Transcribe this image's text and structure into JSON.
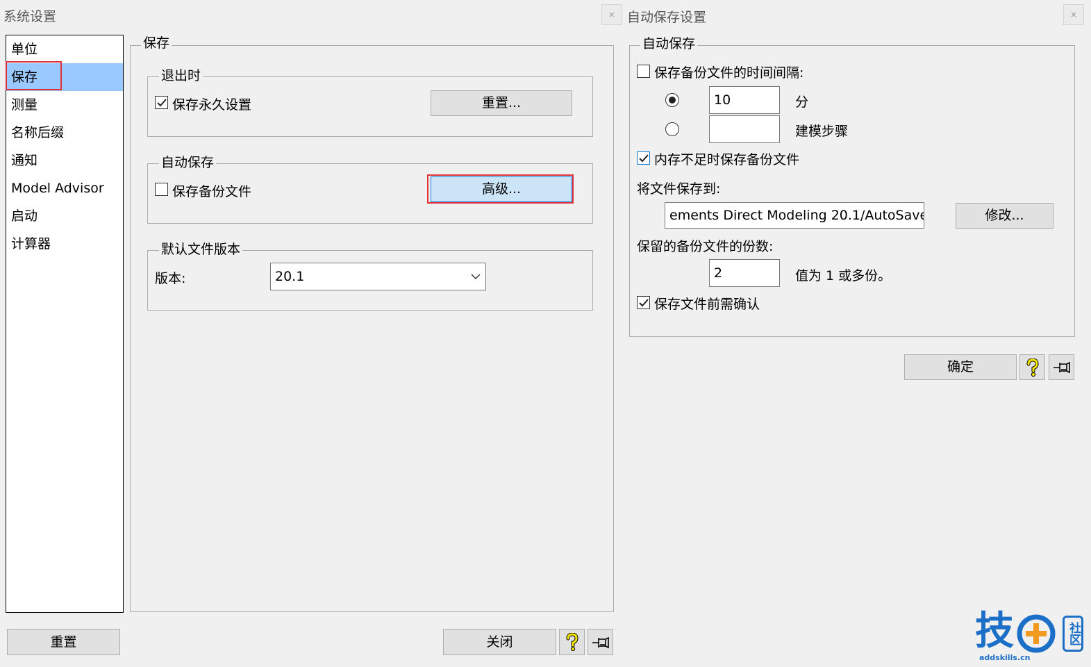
{
  "left": {
    "title": "系统设置",
    "close": "×",
    "nav": [
      "单位",
      "保存",
      "测量",
      "名称后缀",
      "通知",
      "Model Advisor",
      "启动",
      "计算器"
    ],
    "selected_index": 1,
    "panel_title": "保存",
    "exit_group": {
      "title": "退出时",
      "checkbox_label": "保存永久设置",
      "checked": true,
      "button": "重置..."
    },
    "autosave_group": {
      "title": "自动保存",
      "checkbox_label": "保存备份文件",
      "checked": false,
      "button": "高级..."
    },
    "version_group": {
      "title": "默认文件版本",
      "label": "版本:",
      "value": "20.1"
    },
    "footer": {
      "reset": "重置",
      "close": "关闭",
      "help_icon": "help-icon",
      "pin_icon": "pin-icon"
    }
  },
  "right": {
    "title": "自动保存设置",
    "close": "×",
    "group_title": "自动保存",
    "interval_checkbox": "保存备份文件的时间间隔:",
    "interval_checked": false,
    "minutes_value": "10",
    "minutes_unit": "分",
    "minutes_selected": true,
    "steps_value": "",
    "steps_unit": "建模步骤",
    "lowmem_checkbox": "内存不足时保存备份文件",
    "lowmem_checked": true,
    "save_to_label": "将文件保存到:",
    "save_path": "ements Direct Modeling 20.1/AutoSave",
    "modify_button": "修改...",
    "copies_label": "保留的备份文件的份数:",
    "copies_value": "2",
    "copies_hint": "值为 1 或多份。",
    "confirm_checkbox": "保存文件前需确认",
    "confirm_checked": true,
    "ok_button": "确定",
    "help_icon": "help-icon",
    "pin_icon": "pin-icon"
  },
  "watermark": {
    "brand_char": "技",
    "badge_chars": "社区",
    "url": "addskills.cn"
  },
  "colors": {
    "selection": "#99c9ff",
    "highlight_button": "#cce4f7",
    "annotation_red": "#e0323a",
    "brand_blue": "#1c6fc7"
  }
}
